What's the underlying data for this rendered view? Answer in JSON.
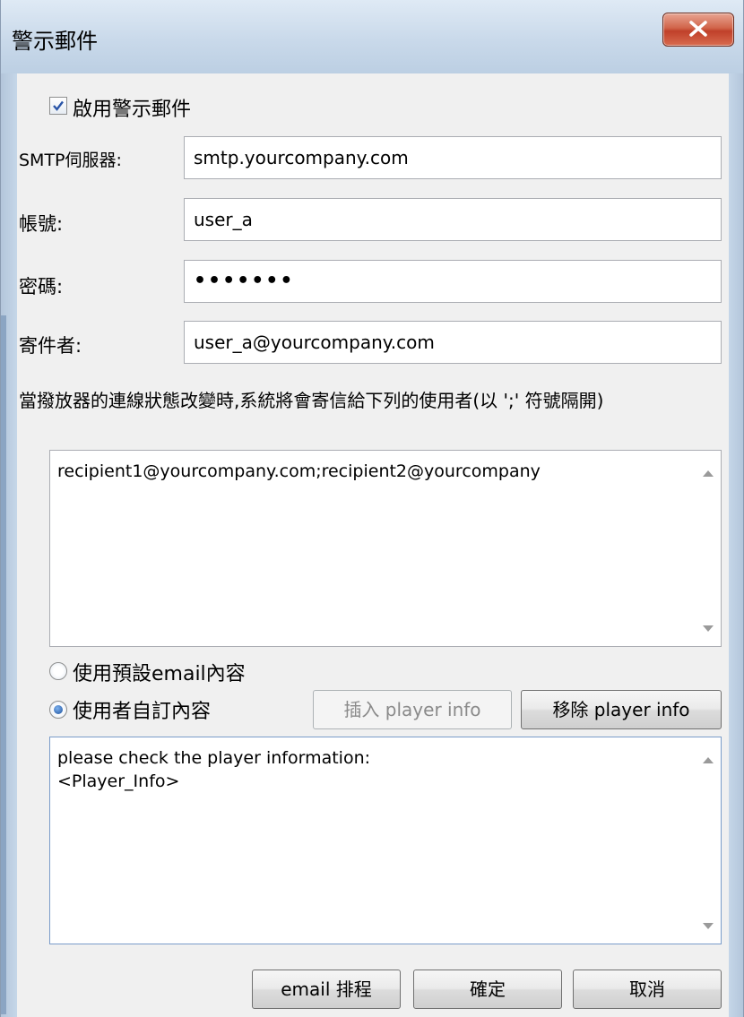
{
  "window": {
    "title": "警示郵件",
    "close_label": "X"
  },
  "enable_checkbox": {
    "label": "啟用警示郵件",
    "checked": true
  },
  "fields": {
    "smtp": {
      "label": "SMTP伺服器:",
      "value": "smtp.yourcompany.com"
    },
    "account": {
      "label": "帳號:",
      "value": "user_a"
    },
    "password": {
      "label": "密碼:",
      "value": "•••••••"
    },
    "sender": {
      "label": "寄件者:",
      "value": "user_a@yourcompany.com"
    }
  },
  "recipients": {
    "description": "當撥放器的連線狀態改變時,系統將會寄信給下列的使用者(以 ';' 符號隔開)",
    "value": "recipient1@yourcompany.com;recipient2@yourcompany"
  },
  "content_options": {
    "default_label": "使用預設email內容",
    "custom_label": "使用者自訂內容",
    "selected": "custom"
  },
  "player_info_buttons": {
    "insert_label": "插入 player info",
    "remove_label": "移除 player info"
  },
  "custom_content": {
    "line1": "please check the player information:",
    "line2": "<Player_Info>"
  },
  "footer": {
    "schedule_label": "email 排程",
    "ok_label": "確定",
    "cancel_label": "取消"
  }
}
